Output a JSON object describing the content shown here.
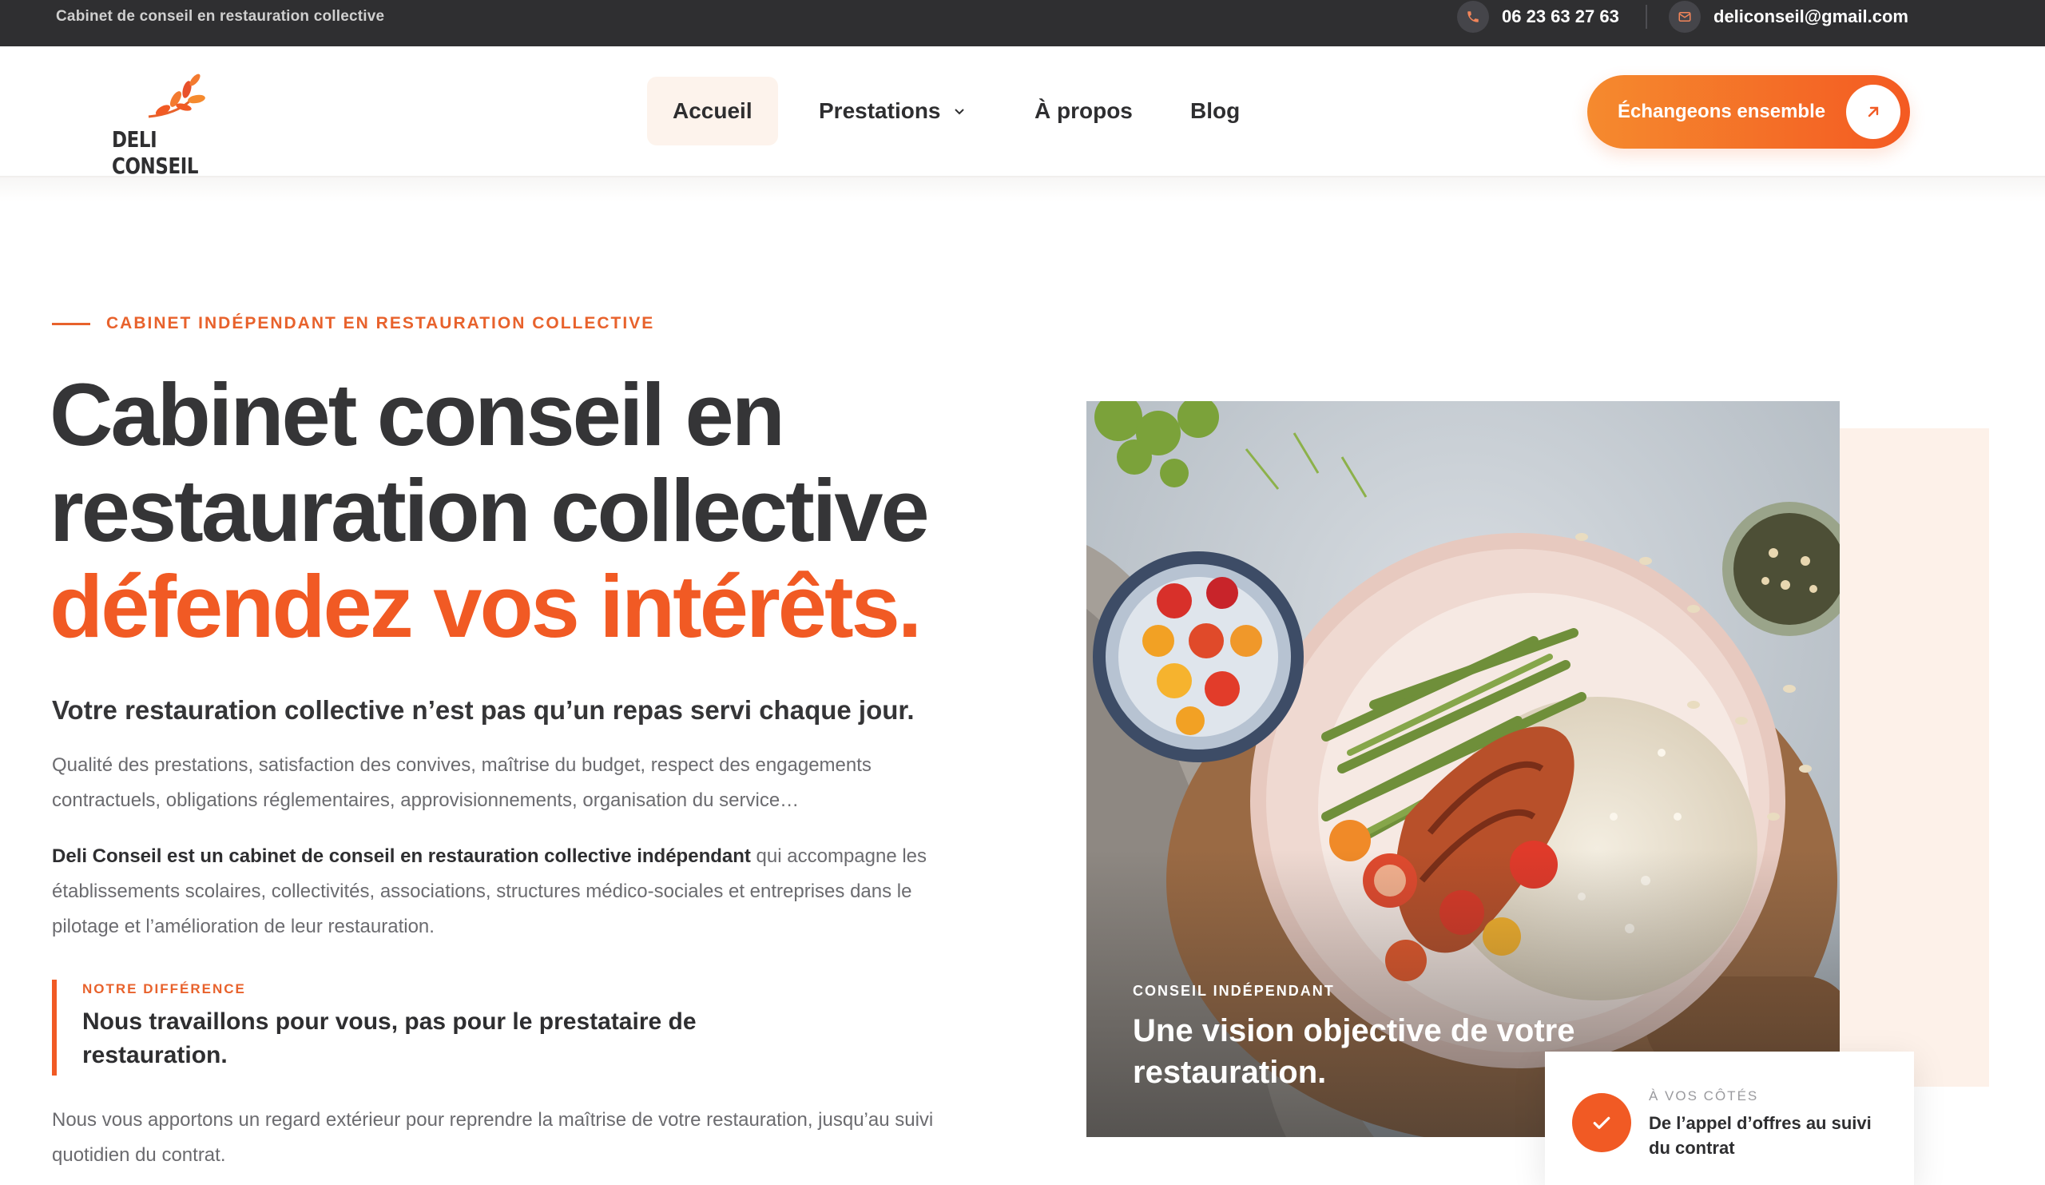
{
  "topbar": {
    "tagline": "Cabinet de conseil en restauration collective",
    "phone": "06 23 63 27 63",
    "email": "deliconseil@gmail.com",
    "phone_icon": "phone-icon",
    "email_icon": "mail-icon"
  },
  "header": {
    "logo_text": "DELI CONSEIL",
    "nav": {
      "home": "Accueil",
      "prestations": "Prestations",
      "about": "À propos",
      "blog": "Blog"
    },
    "cta_label": "Échangeons ensemble",
    "cta_icon": "arrow-up-right-icon"
  },
  "hero": {
    "eyebrow": "CABINET INDÉPENDANT EN RESTAURATION COLLECTIVE",
    "title_line1": "Cabinet conseil en",
    "title_line2": "restauration collective",
    "title_accent": "défendez vos intérêts.",
    "lead": "Votre restauration collective n’est pas qu’un repas servi chaque jour.",
    "para1": "Qualité des prestations, satisfaction des convives, maîtrise du budget, respect des engagements contractuels, obligations réglementaires, approvisionnements, organisation du service…",
    "para2_strong": "Deli Conseil est un cabinet de conseil en restauration collective indépendant",
    "para2_rest": " qui accompagne les établissements scolaires, collectivités, associations, structures médico-sociales et entreprises dans le pilotage et l’amélioration de leur restauration.",
    "quote_label": "NOTRE DIFFÉRENCE",
    "quote_text": "Nous travaillons pour vous, pas pour le prestataire de restauration.",
    "para3": "Nous vous apportons un regard extérieur pour reprendre la maîtrise de votre restauration, jusqu’au suivi quotidien du contrat."
  },
  "image_panel": {
    "caption_label": "CONSEIL INDÉPENDANT",
    "caption_title": "Une vision objective de votre restauration.",
    "card_label": "À VOS CÔTÉS",
    "card_text": "De l’appel d’offres au suivi du contrat",
    "card_icon": "check-icon"
  },
  "colors": {
    "accent": "#f15a24",
    "accent_light": "#f58a2e",
    "dark": "#2f2f31",
    "soft_peach": "#fdf1e9"
  }
}
